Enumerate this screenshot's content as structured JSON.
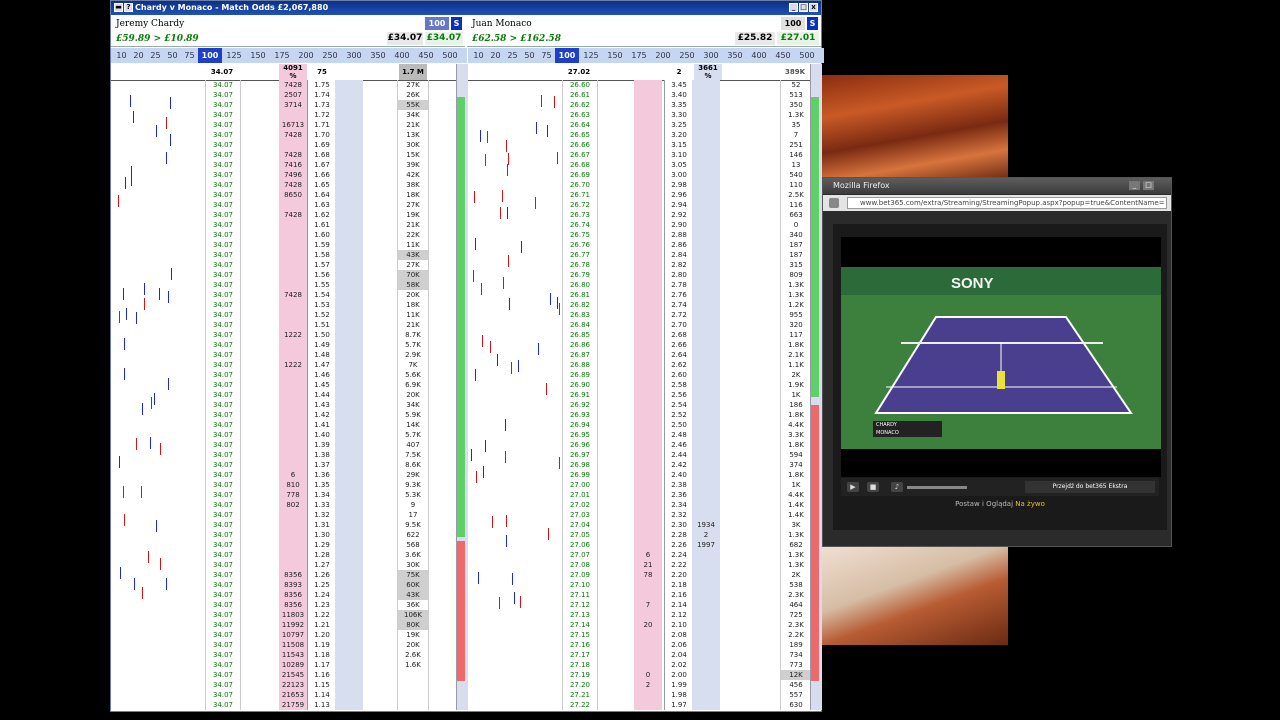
{
  "window": {
    "title": "Chardy v Monaco - Match Odds   £2,067,880"
  },
  "runners": [
    {
      "name": "Jeremy Chardy",
      "pl": "£59.89  > £10.89",
      "stake": "100",
      "s_btn": "S",
      "back": "£34.07",
      "lay": "£34.07",
      "ltp": "34.07",
      "bet_col": "4091 %",
      "stake_col": "75",
      "vol_hdr": "1.7 M"
    },
    {
      "name": "Juan Monaco",
      "pl": "£62.58  > £162.58",
      "stake": "100",
      "s_btn": "S",
      "back": "£25.82",
      "lay": "£27.01",
      "ltp": "27.02",
      "bet_col": "",
      "stake_col": "2",
      "pct_hdr": "3661 %",
      "vol_hdr": "389K"
    }
  ],
  "stakes": [
    "10",
    "20",
    "25",
    "50",
    "75",
    "100",
    "125",
    "150",
    "175",
    "200",
    "250",
    "300",
    "350",
    "400",
    "450",
    "500"
  ],
  "selected_stake": "100",
  "left_ladder": {
    "ltp": "34.07",
    "rows": [
      [
        "7428",
        "1.75",
        "27K"
      ],
      [
        "2507",
        "1.74",
        "26K"
      ],
      [
        "3714",
        "1.73",
        "55K"
      ],
      [
        "",
        "1.72",
        "34K"
      ],
      [
        "16713",
        "1.71",
        "21K"
      ],
      [
        "7428",
        "1.70",
        "13K"
      ],
      [
        "",
        "1.69",
        "30K"
      ],
      [
        "7428",
        "1.68",
        "15K"
      ],
      [
        "7416",
        "1.67",
        "39K"
      ],
      [
        "7496",
        "1.66",
        "42K"
      ],
      [
        "7428",
        "1.65",
        "38K"
      ],
      [
        "8650",
        "1.64",
        "18K"
      ],
      [
        "",
        "1.63",
        "27K"
      ],
      [
        "7428",
        "1.62",
        "19K"
      ],
      [
        "",
        "1.61",
        "21K"
      ],
      [
        "",
        "1.60",
        "22K"
      ],
      [
        "",
        "1.59",
        "11K"
      ],
      [
        "",
        "1.58",
        "43K"
      ],
      [
        "",
        "1.57",
        "27K"
      ],
      [
        "",
        "1.56",
        "70K"
      ],
      [
        "",
        "1.55",
        "58K"
      ],
      [
        "7428",
        "1.54",
        "20K"
      ],
      [
        "",
        "1.53",
        "18K"
      ],
      [
        "",
        "1.52",
        "11K"
      ],
      [
        "",
        "1.51",
        "21K"
      ],
      [
        "1222",
        "1.50",
        "8.7K"
      ],
      [
        "",
        "1.49",
        "5.7K"
      ],
      [
        "",
        "1.48",
        "2.9K"
      ],
      [
        "1222",
        "1.47",
        "7K"
      ],
      [
        "",
        "1.46",
        "5.6K"
      ],
      [
        "",
        "1.45",
        "6.9K"
      ],
      [
        "",
        "1.44",
        "20K"
      ],
      [
        "",
        "1.43",
        "34K"
      ],
      [
        "",
        "1.42",
        "5.9K"
      ],
      [
        "",
        "1.41",
        "14K"
      ],
      [
        "",
        "1.40",
        "5.7K"
      ],
      [
        "",
        "1.39",
        "407"
      ],
      [
        "",
        "1.38",
        "7.5K"
      ],
      [
        "",
        "1.37",
        "8.6K"
      ],
      [
        "6",
        "1.36",
        "29K"
      ],
      [
        "810",
        "1.35",
        "9.3K"
      ],
      [
        "778",
        "1.34",
        "5.3K"
      ],
      [
        "802",
        "1.33",
        "9"
      ],
      [
        "",
        "1.32",
        "17"
      ],
      [
        "",
        "1.31",
        "9.5K"
      ],
      [
        "",
        "1.30",
        "622"
      ],
      [
        "",
        "1.29",
        "568"
      ],
      [
        "",
        "1.28",
        "3.6K"
      ],
      [
        "",
        "1.27",
        "30K"
      ],
      [
        "8356",
        "1.26",
        "75K"
      ],
      [
        "8393",
        "1.25",
        "60K"
      ],
      [
        "8356",
        "1.24",
        "43K"
      ],
      [
        "8356",
        "1.23",
        "36K"
      ],
      [
        "11803",
        "1.22",
        "106K"
      ],
      [
        "11992",
        "1.21",
        "80K"
      ],
      [
        "10797",
        "1.20",
        "19K"
      ],
      [
        "11508",
        "1.19",
        "20K"
      ],
      [
        "11543",
        "1.18",
        "2.6K"
      ],
      [
        "10289",
        "1.17",
        "1.6K"
      ],
      [
        "21545",
        "1.16",
        ""
      ],
      [
        "22123",
        "1.15",
        ""
      ],
      [
        "21653",
        "1.14",
        ""
      ],
      [
        "21759",
        "1.13",
        ""
      ]
    ]
  },
  "right_ladder": {
    "ltp": "27.02",
    "rows": [
      [
        "26.60",
        "",
        "3.45",
        "",
        "52"
      ],
      [
        "26.61",
        "",
        "3.40",
        "",
        "513"
      ],
      [
        "26.62",
        "",
        "3.35",
        "",
        "350"
      ],
      [
        "26.63",
        "",
        "3.30",
        "",
        "1.3K"
      ],
      [
        "26.64",
        "",
        "3.25",
        "",
        "35"
      ],
      [
        "26.65",
        "",
        "3.20",
        "",
        "7"
      ],
      [
        "26.66",
        "",
        "3.15",
        "",
        "251"
      ],
      [
        "26.67",
        "",
        "3.10",
        "",
        "146"
      ],
      [
        "26.68",
        "",
        "3.05",
        "",
        "13"
      ],
      [
        "26.69",
        "",
        "3.00",
        "",
        "540"
      ],
      [
        "26.70",
        "",
        "2.98",
        "",
        "110"
      ],
      [
        "26.71",
        "",
        "2.96",
        "",
        "2.5K"
      ],
      [
        "26.72",
        "",
        "2.94",
        "",
        "116"
      ],
      [
        "26.73",
        "",
        "2.92",
        "",
        "663"
      ],
      [
        "26.74",
        "",
        "2.90",
        "",
        "0"
      ],
      [
        "26.75",
        "",
        "2.88",
        "",
        "340"
      ],
      [
        "26.76",
        "",
        "2.86",
        "",
        "187"
      ],
      [
        "26.77",
        "",
        "2.84",
        "",
        "187"
      ],
      [
        "26.78",
        "",
        "2.82",
        "",
        "315"
      ],
      [
        "26.79",
        "",
        "2.80",
        "",
        "809"
      ],
      [
        "26.80",
        "",
        "2.78",
        "",
        "1.3K"
      ],
      [
        "26.81",
        "",
        "2.76",
        "",
        "1.3K"
      ],
      [
        "26.82",
        "",
        "2.74",
        "",
        "1.2K"
      ],
      [
        "26.83",
        "",
        "2.72",
        "",
        "955"
      ],
      [
        "26.84",
        "",
        "2.70",
        "",
        "320"
      ],
      [
        "26.85",
        "",
        "2.68",
        "",
        "117"
      ],
      [
        "26.86",
        "",
        "2.66",
        "",
        "1.8K"
      ],
      [
        "26.87",
        "",
        "2.64",
        "",
        "2.1K"
      ],
      [
        "26.88",
        "",
        "2.62",
        "",
        "1.1K"
      ],
      [
        "26.89",
        "",
        "2.60",
        "",
        "2K"
      ],
      [
        "26.90",
        "",
        "2.58",
        "",
        "1.9K"
      ],
      [
        "26.91",
        "",
        "2.56",
        "",
        "1K"
      ],
      [
        "26.92",
        "",
        "2.54",
        "",
        "186"
      ],
      [
        "26.93",
        "",
        "2.52",
        "",
        "1.8K"
      ],
      [
        "26.94",
        "",
        "2.50",
        "",
        "4.4K"
      ],
      [
        "26.95",
        "",
        "2.48",
        "",
        "3.3K"
      ],
      [
        "26.96",
        "",
        "2.46",
        "",
        "1.8K"
      ],
      [
        "26.97",
        "",
        "2.44",
        "",
        "594"
      ],
      [
        "26.98",
        "",
        "2.42",
        "",
        "374"
      ],
      [
        "26.99",
        "",
        "2.40",
        "",
        "1.8K"
      ],
      [
        "27.00",
        "",
        "2.38",
        "",
        "1K"
      ],
      [
        "27.01",
        "",
        "2.36",
        "",
        "4.4K"
      ],
      [
        "27.02",
        "",
        "2.34",
        "",
        "1.4K"
      ],
      [
        "27.03",
        "",
        "2.32",
        "",
        "1.4K"
      ],
      [
        "27.04",
        "",
        "2.30",
        "1934",
        "3K"
      ],
      [
        "27.05",
        "",
        "2.28",
        "2",
        "1.3K"
      ],
      [
        "27.06",
        "",
        "2.26",
        "1997",
        "682"
      ],
      [
        "27.07",
        "6",
        "2.24",
        "",
        "1.3K"
      ],
      [
        "27.08",
        "21",
        "2.22",
        "",
        "1.3K"
      ],
      [
        "27.09",
        "78",
        "2.20",
        "",
        "2K"
      ],
      [
        "27.10",
        "",
        "2.18",
        "",
        "538"
      ],
      [
        "27.11",
        "",
        "2.16",
        "",
        "2.3K"
      ],
      [
        "27.12",
        "7",
        "2.14",
        "",
        "464"
      ],
      [
        "27.13",
        "",
        "2.12",
        "",
        "725"
      ],
      [
        "27.14",
        "20",
        "2.10",
        "",
        "2.3K"
      ],
      [
        "27.15",
        "",
        "2.08",
        "",
        "2.2K"
      ],
      [
        "27.16",
        "",
        "2.06",
        "",
        "189"
      ],
      [
        "27.17",
        "",
        "2.04",
        "",
        "734"
      ],
      [
        "27.18",
        "",
        "2.02",
        "",
        "773"
      ],
      [
        "27.19",
        "0",
        "2.00",
        "",
        "12K"
      ],
      [
        "27.20",
        "2",
        "1.99",
        "",
        "456"
      ],
      [
        "27.21",
        "",
        "1.98",
        "",
        "557"
      ],
      [
        "27.22",
        "",
        "1.97",
        "",
        "630"
      ]
    ]
  },
  "firefox": {
    "title": "Mozilla Firefox",
    "url": "www.bet365.com/extra/Streaming/StreamingPopup.aspx?popup=true&ContentName=",
    "score_p1": "CHARDY",
    "score_p2": "MONACO",
    "banner": "SONY",
    "extra_btn": "Przejdź do bet365 Ekstra",
    "footer_a": "Postaw i Oglądaj",
    "footer_b": "Na żywo"
  },
  "colors": {
    "title_blue": "#1a45a8",
    "back_pink": "#f3c9db",
    "lay_blue": "#d6deef",
    "green": "#0a7a0a"
  }
}
